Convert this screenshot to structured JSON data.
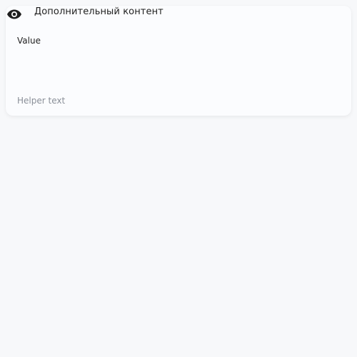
{
  "header": {
    "icon": "eye-icon",
    "title": "Дополнительный контент"
  },
  "field": {
    "value": "Value",
    "helper_text": "Helper text"
  },
  "colors": {
    "background": "#f7f8fa",
    "card": "#fbfcfe",
    "text": "#1f1f1f",
    "helper": "#8a8f98"
  }
}
